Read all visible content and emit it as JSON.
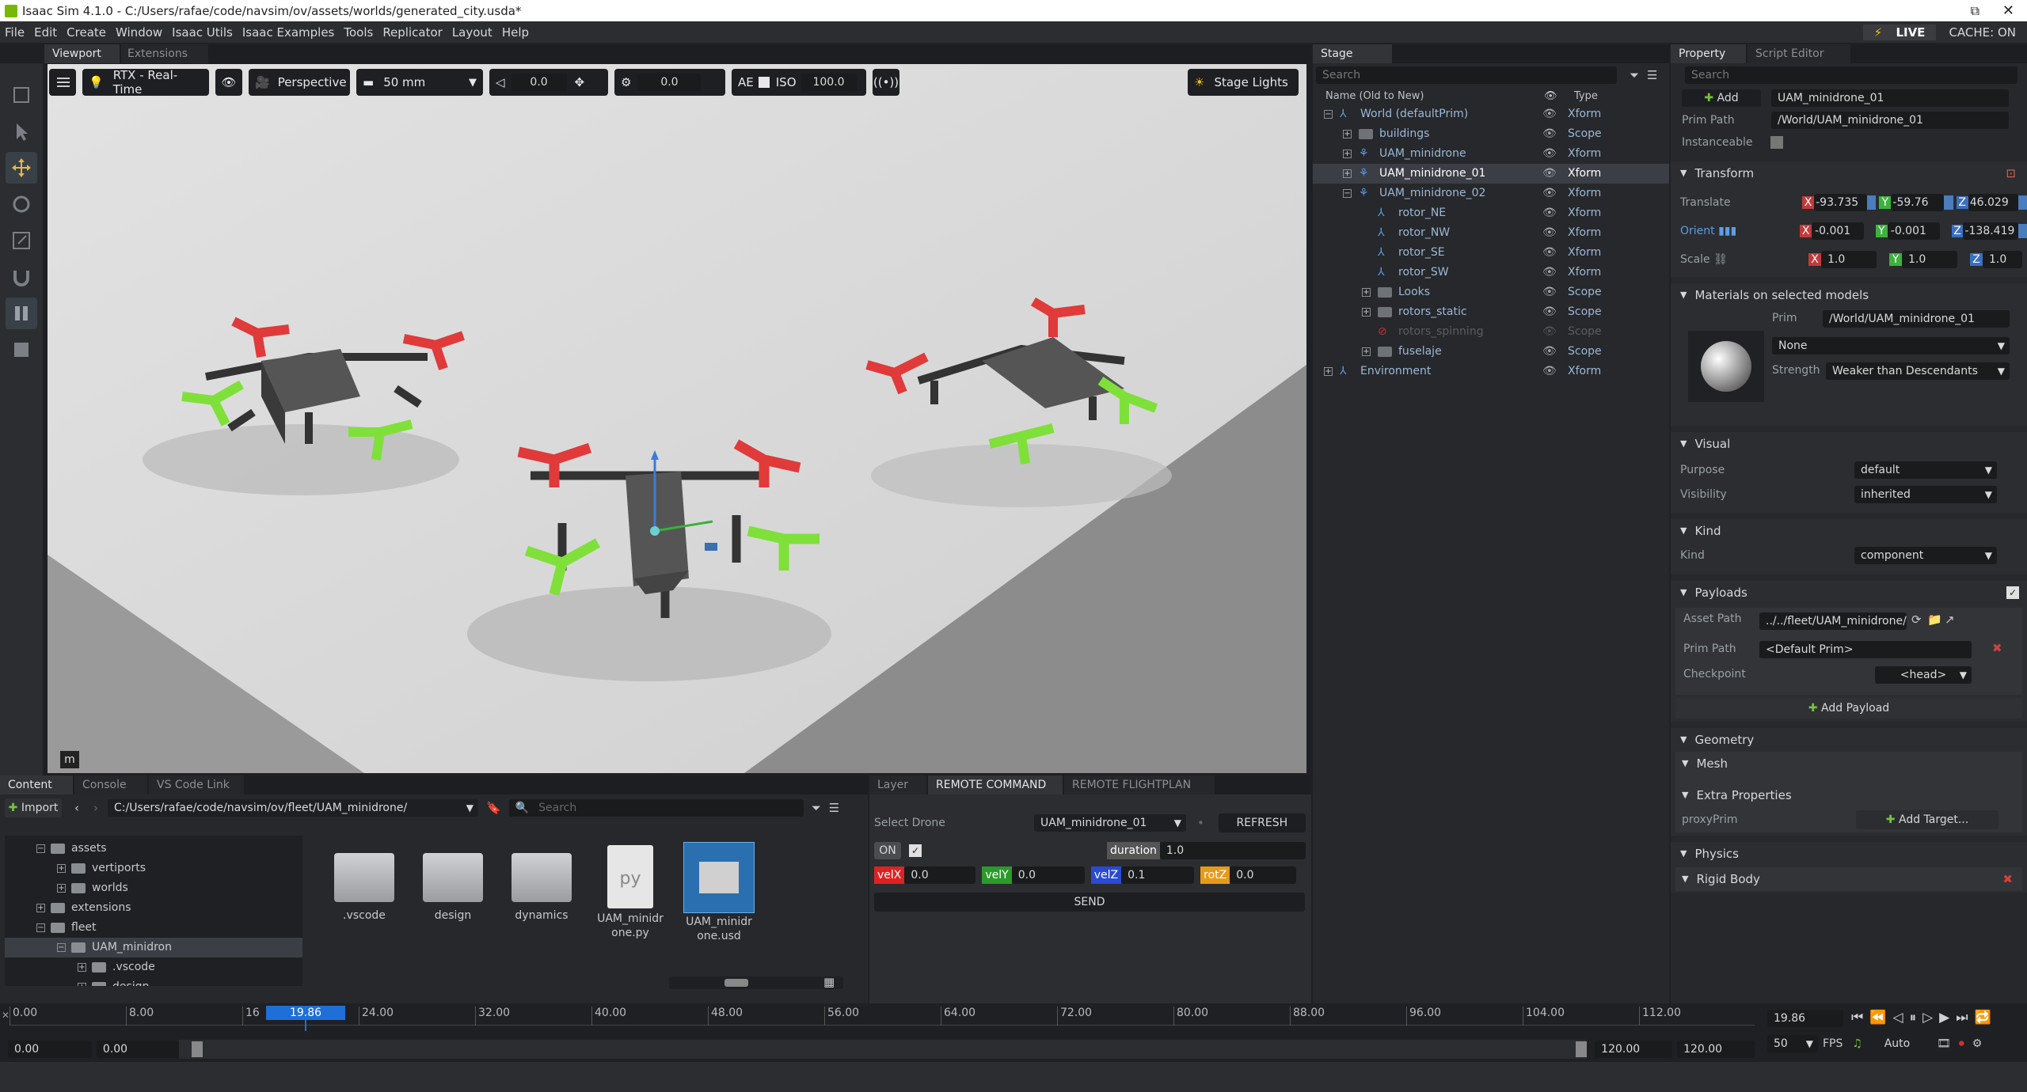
{
  "window": {
    "title": "Isaac Sim 4.1.0 - C:/Users/rafae/code/navsim/ov/assets/worlds/generated_city.usda*"
  },
  "menu": [
    "File",
    "Edit",
    "Create",
    "Window",
    "Isaac Utils",
    "Isaac Examples",
    "Tools",
    "Replicator",
    "Layout",
    "Help"
  ],
  "status": {
    "live": "LIVE",
    "cache": "CACHE: ON"
  },
  "viewport": {
    "tabs": [
      "Viewport",
      "Extensions"
    ],
    "renderer": "RTX - Real-Time",
    "camera": "Perspective",
    "lens": "50 mm",
    "fov_value": "0.0",
    "exposure_value": "0.0",
    "ae": "AE",
    "iso_label": "ISO",
    "iso_value": "100.0",
    "stage_lights": "Stage Lights",
    "corner_label": "m"
  },
  "stage": {
    "tab": "Stage",
    "search_placeholder": "Search",
    "col_name": "Name (Old to New)",
    "col_type": "Type",
    "rows": [
      {
        "name": "World (defaultPrim)",
        "type": "Xform"
      },
      {
        "name": "buildings",
        "type": "Scope"
      },
      {
        "name": "UAM_minidrone",
        "type": "Xform"
      },
      {
        "name": "UAM_minidrone_01",
        "type": "Xform"
      },
      {
        "name": "UAM_minidrone_02",
        "type": "Xform"
      },
      {
        "name": "rotor_NE",
        "type": "Xform"
      },
      {
        "name": "rotor_NW",
        "type": "Xform"
      },
      {
        "name": "rotor_SE",
        "type": "Xform"
      },
      {
        "name": "rotor_SW",
        "type": "Xform"
      },
      {
        "name": "Looks",
        "type": "Scope"
      },
      {
        "name": "rotors_static",
        "type": "Scope"
      },
      {
        "name": "rotors_spinning",
        "type": "Scope"
      },
      {
        "name": "fuselaje",
        "type": "Scope"
      },
      {
        "name": "Environment",
        "type": "Xform"
      }
    ]
  },
  "property": {
    "tabs": [
      "Property",
      "Script Editor"
    ],
    "search_placeholder": "Search",
    "add": "Add",
    "prim_name": "UAM_minidrone_01",
    "prim_path_label": "Prim Path",
    "prim_path": "/World/UAM_minidrone_01",
    "instanceable": "Instanceable",
    "transform": "Transform",
    "translate": "Translate",
    "tx": "-93.735",
    "ty": "-59.76",
    "tz": "46.029",
    "orient": "Orient",
    "ox": "-0.001",
    "oy": "-0.001",
    "oz": "-138.419",
    "scale": "Scale",
    "sx": "1.0",
    "sy": "1.0",
    "sz": "1.0",
    "materials": "Materials on selected models",
    "mat_prim_label": "Prim",
    "mat_prim": "/World/UAM_minidrone_01",
    "mat_none": "None",
    "strength_label": "Strength",
    "strength": "Weaker than Descendants",
    "visual": "Visual",
    "purpose_label": "Purpose",
    "purpose": "default",
    "visibility_label": "Visibility",
    "visibility": "inherited",
    "kind_sect": "Kind",
    "kind_label": "Kind",
    "kind": "component",
    "payloads": "Payloads",
    "asset_path_label": "Asset Path",
    "asset_path": "../../fleet/UAM_minidrone/",
    "pl_prim_path_label": "Prim Path",
    "pl_prim_path": "<Default Prim>",
    "checkpoint_label": "Checkpoint",
    "checkpoint": "<head>",
    "add_payload": "Add Payload",
    "geometry": "Geometry",
    "mesh": "Mesh",
    "extra": "Extra Properties",
    "proxyprim": "proxyPrim",
    "add_target": "Add Target...",
    "physics": "Physics",
    "rigid_body": "Rigid Body"
  },
  "content": {
    "tabs": [
      "Content",
      "Console",
      "VS Code Link"
    ],
    "import": "Import",
    "path": "C:/Users/rafae/code/navsim/ov/fleet/UAM_minidrone/",
    "search_placeholder": "Search",
    "tree": [
      {
        "name": "assets",
        "indent": 1
      },
      {
        "name": "vertiports",
        "indent": 2
      },
      {
        "name": "worlds",
        "indent": 2
      },
      {
        "name": "extensions",
        "indent": 1
      },
      {
        "name": "fleet",
        "indent": 1
      },
      {
        "name": "UAM_minidron",
        "indent": 2
      },
      {
        "name": ".vscode",
        "indent": 3
      },
      {
        "name": "design",
        "indent": 3
      }
    ],
    "files": [
      {
        "name": ".vscode",
        "kind": "folder"
      },
      {
        "name": "design",
        "kind": "folder"
      },
      {
        "name": "dynamics",
        "kind": "folder"
      },
      {
        "name": "UAM_minidrone.py",
        "kind": "py"
      },
      {
        "name": "UAM_minidrone.usd",
        "kind": "usd"
      }
    ]
  },
  "remote": {
    "tabs": [
      "Layer",
      "REMOTE COMMAND",
      "REMOTE FLIGHTPLAN"
    ],
    "select_label": "Select Drone",
    "drone": "UAM_minidrone_01",
    "refresh": "REFRESH",
    "on": "ON",
    "duration_label": "duration",
    "duration": "1.0",
    "velx_label": "velX",
    "velx": "0.0",
    "vely_label": "velY",
    "vely": "0.0",
    "velz_label": "velZ",
    "velz": "0.1",
    "rotz_label": "rotZ",
    "rotz": "0.0",
    "send": "SEND"
  },
  "timeline": {
    "ticks": [
      "0.00",
      "8.00",
      "16",
      "24.00",
      "32.00",
      "40.00",
      "48.00",
      "56.00",
      "64.00",
      "72.00",
      "80.00",
      "88.00",
      "96.00",
      "104.00",
      "112.00"
    ],
    "current": "19.86",
    "current_field": "19.86",
    "start": "0.00",
    "start2": "0.00",
    "end": "120.00",
    "end2": "120.00",
    "fps": "50",
    "fps_label": "FPS",
    "auto": "Auto"
  }
}
